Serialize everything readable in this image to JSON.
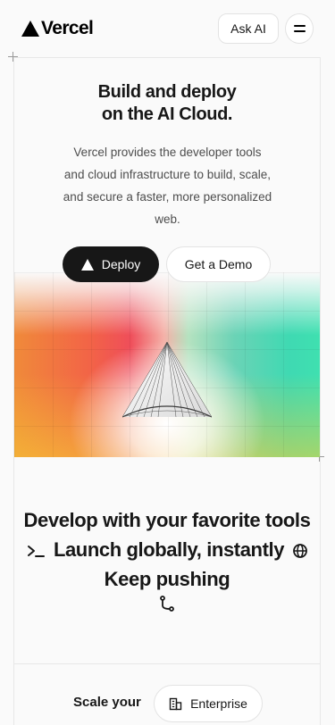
{
  "header": {
    "logo_text": "Vercel",
    "ask_ai_label": "Ask AI",
    "menu_icon": "hamburger-icon"
  },
  "hero": {
    "title_line1": "Build and deploy",
    "title_line2": "on the AI Cloud.",
    "description": "Vercel provides the developer tools and cloud infrastructure to build, scale, and secure a faster, more personalized web.",
    "deploy_label": "Deploy",
    "demo_label": "Get a Demo"
  },
  "features": {
    "part1": "Develop with your favorite tools",
    "part2": "Launch globally, instantly",
    "part3": "Keep pushing",
    "icons": [
      "terminal-icon",
      "globe-icon",
      "git-branch-icon"
    ]
  },
  "scale": {
    "label": "Scale your",
    "enterprise_label": "Enterprise",
    "enterprise_icon": "building-icon"
  },
  "colors": {
    "primary": "#171717",
    "background": "#fafafa",
    "muted_text": "#4d4d4d"
  }
}
